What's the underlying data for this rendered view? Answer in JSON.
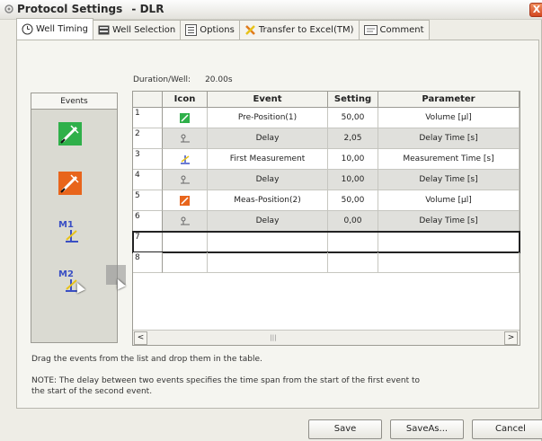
{
  "window": {
    "title": "Protocol Settings",
    "subtitle": "- DLR",
    "close_label": "X"
  },
  "tabs": [
    {
      "label": "Well Timing",
      "icon": "clock-icon",
      "active": true
    },
    {
      "label": "Well Selection",
      "icon": "grid-icon",
      "active": false
    },
    {
      "label": "Options",
      "icon": "options-icon",
      "active": false
    },
    {
      "label": "Transfer to Excel(TM)",
      "icon": "excel-icon",
      "active": false
    },
    {
      "label": "Comment",
      "icon": "comment-icon",
      "active": false
    }
  ],
  "duration": {
    "label": "Duration/Well:",
    "value": "20.00s"
  },
  "events_panel": {
    "header": "Events",
    "items": [
      {
        "name": "green-injector-icon",
        "label": ""
      },
      {
        "name": "orange-injector-icon",
        "label": ""
      },
      {
        "name": "measurement-1-icon",
        "label": "M1"
      },
      {
        "name": "measurement-2-icon",
        "label": "M2"
      }
    ]
  },
  "table": {
    "columns": [
      "",
      "Icon",
      "Event",
      "Setting",
      "Parameter"
    ],
    "rows": [
      {
        "num": "1",
        "icon": "green-injector-icon",
        "event": "Pre-Position(1)",
        "setting": "50,00",
        "parameter": "Volume [µl]",
        "shaded": false
      },
      {
        "num": "2",
        "icon": "delay-icon",
        "event": "Delay",
        "setting": "2,05",
        "parameter": "Delay Time [s]",
        "shaded": true
      },
      {
        "num": "3",
        "icon": "measurement-icon",
        "event": "First Measurement",
        "setting": "10,00",
        "parameter": "Measurement Time [s]",
        "shaded": false
      },
      {
        "num": "4",
        "icon": "delay-icon",
        "event": "Delay",
        "setting": "10,00",
        "parameter": "Delay Time [s]",
        "shaded": true
      },
      {
        "num": "5",
        "icon": "orange-injector-icon",
        "event": "Meas-Position(2)",
        "setting": "50,00",
        "parameter": "Volume [µl]",
        "shaded": false
      },
      {
        "num": "6",
        "icon": "delay-icon",
        "event": "Delay",
        "setting": "0,00",
        "parameter": "Delay Time [s]",
        "shaded": true
      },
      {
        "num": "7",
        "icon": "",
        "event": "",
        "setting": "",
        "parameter": "",
        "shaded": false
      },
      {
        "num": "8",
        "icon": "",
        "event": "",
        "setting": "",
        "parameter": "",
        "shaded": false
      }
    ]
  },
  "hint": "Drag the events from the list and drop them in the table.",
  "note": "NOTE: The delay between two events specifies the time span from the start of the first event to the start of the second event.",
  "buttons": {
    "save": "Save",
    "save_as": "SaveAs...",
    "cancel": "Cancel"
  },
  "colors": {
    "green_injector": "#2fb04a",
    "orange_injector": "#e8651c",
    "measurement_blue": "#3a4fc4"
  }
}
